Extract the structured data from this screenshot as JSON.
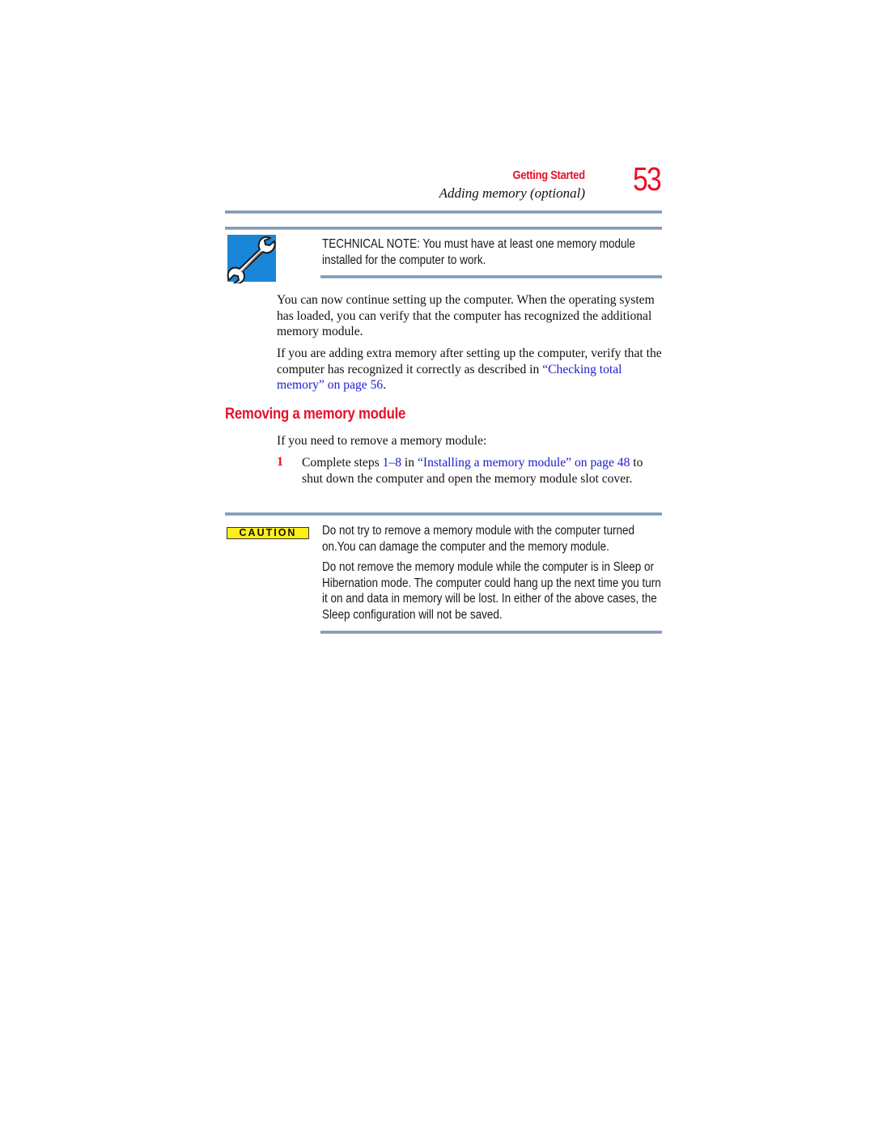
{
  "header": {
    "section": "Getting Started",
    "subtitle": "Adding memory (optional)",
    "page_number": "53"
  },
  "technical_note": {
    "icon": "wrench-icon",
    "text": "TECHNICAL NOTE: You must have at least one memory module installed for the computer to work."
  },
  "paragraphs": [
    {
      "text": "You can now continue setting up the computer. When the operating system has loaded, you can verify that the computer has recognized the additional memory module."
    },
    {
      "text_before": "If you are adding extra memory after setting up the computer, verify that the computer has recognized it correctly as described in ",
      "link": "“Checking total memory” on page 56",
      "text_after": "."
    }
  ],
  "section": {
    "heading": "Removing a memory module",
    "intro": "If you need to remove a memory module:",
    "steps": [
      {
        "number": "1",
        "text_before": "Complete steps ",
        "link1": "1–8",
        "text_mid": " in ",
        "link2": "“Installing a memory module” on page 48",
        "text_after": " to shut down the computer and open the memory module slot cover."
      }
    ]
  },
  "caution": {
    "badge": "CAUTION",
    "paragraphs": [
      "Do not try to remove a memory module with the computer turned on.You can damage the computer and the memory module.",
      "Do not remove the memory module while the computer is in Sleep or Hibernation mode. The computer could hang up the next time you turn it on and data in memory will be lost. In either of the above cases, the Sleep configuration will not be saved."
    ]
  },
  "colors": {
    "accent_red": "#e8102a",
    "link_blue": "#1c1ccf",
    "rule_blue": "#7c97b1",
    "icon_blue": "#1a86d8",
    "caution_yellow": "#ffee1a"
  }
}
